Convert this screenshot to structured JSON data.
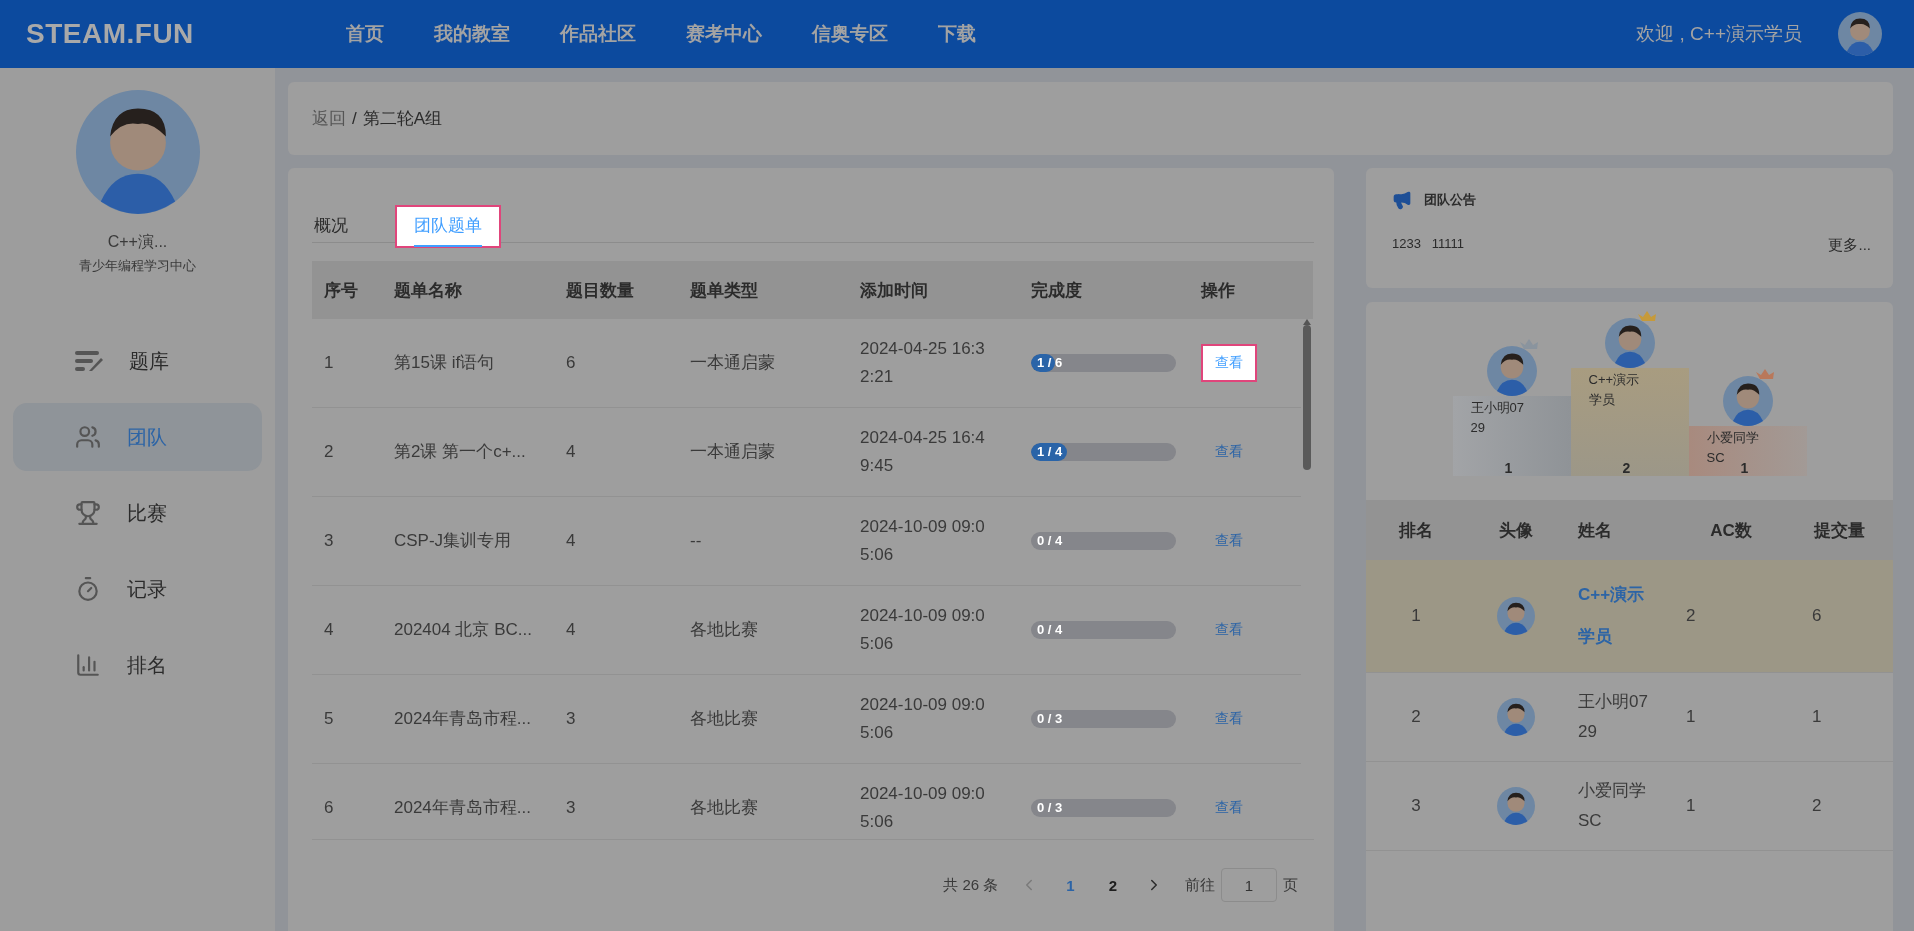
{
  "header": {
    "brand": "STEAM.FUN",
    "nav": [
      "首页",
      "我的教室",
      "作品社区",
      "赛考中心",
      "信奥专区",
      "下载"
    ],
    "welcome": "欢迎 , C++演示学员"
  },
  "sidebar": {
    "user_name": "C++演...",
    "org": "青少年编程学习中心",
    "items": [
      {
        "label": "题库",
        "selected": false
      },
      {
        "label": "团队",
        "selected": true
      },
      {
        "label": "比赛",
        "selected": false
      },
      {
        "label": "记录",
        "selected": false
      },
      {
        "label": "排名",
        "selected": false
      }
    ]
  },
  "breadcrumb": {
    "back": "返回",
    "separator": "/",
    "current": "第二轮A组"
  },
  "tabs": [
    {
      "label": "概况",
      "selected": false,
      "highlighted": false
    },
    {
      "label": "团队题单",
      "selected": true,
      "highlighted": true
    }
  ],
  "table": {
    "columns": [
      "序号",
      "题单名称",
      "题目数量",
      "题单类型",
      "添加时间",
      "完成度",
      "操作"
    ],
    "rows": [
      {
        "index": "1",
        "name": "第15课 if语句",
        "count": "6",
        "type": "一本通启蒙",
        "added": "2024-04-25 16:32:21",
        "progress": {
          "label": "1 / 6",
          "level": 0.1667
        },
        "action": {
          "label": "查看",
          "highlighted": true
        }
      },
      {
        "index": "2",
        "name": "第2课 第一个c+...",
        "count": "4",
        "type": "一本通启蒙",
        "added": "2024-04-25 16:49:45",
        "progress": {
          "label": "1 / 4",
          "level": 0.25
        },
        "action": {
          "label": "查看",
          "highlighted": false
        }
      },
      {
        "index": "3",
        "name": "CSP-J集训专用",
        "count": "4",
        "type": "--",
        "added": "2024-10-09 09:05:06",
        "progress": {
          "label": "0 / 4",
          "level": 0
        },
        "action": {
          "label": "查看",
          "highlighted": false
        }
      },
      {
        "index": "4",
        "name": "202404 北京 BC...",
        "count": "4",
        "type": "各地比赛",
        "added": "2024-10-09 09:05:06",
        "progress": {
          "label": "0 / 4",
          "level": 0
        },
        "action": {
          "label": "查看",
          "highlighted": false
        }
      },
      {
        "index": "5",
        "name": "2024年青岛市程...",
        "count": "3",
        "type": "各地比赛",
        "added": "2024-10-09 09:05:06",
        "progress": {
          "label": "0 / 3",
          "level": 0
        },
        "action": {
          "label": "查看",
          "highlighted": false
        }
      },
      {
        "index": "6",
        "name": "2024年青岛市程...",
        "count": "3",
        "type": "各地比赛",
        "added": "2024-10-09 09:05:06",
        "progress": {
          "label": "0 / 3",
          "level": 0
        },
        "action": {
          "label": "查看",
          "highlighted": false
        }
      }
    ]
  },
  "pagination": {
    "total": "共 26 条",
    "pages": [
      {
        "label": "1",
        "selected": true
      },
      {
        "label": "2",
        "selected": false
      }
    ],
    "goto_label": "前往",
    "goto_value": "1",
    "page_suffix": "页"
  },
  "announcement": {
    "title": "团队公告",
    "text": "1233   11111",
    "more": "更多..."
  },
  "podium": [
    {
      "name": "王小明0729",
      "count": "1",
      "color": "#8a949e"
    },
    {
      "name": "C++演示学员",
      "count": "2",
      "color": "#c69a3a"
    },
    {
      "name": "小爱同学SC",
      "count": "1",
      "color": "#b9785a"
    }
  ],
  "ranking": {
    "columns": [
      "排名",
      "头像",
      "姓名",
      "AC数",
      "提交量"
    ],
    "rows": [
      {
        "rank": "1",
        "name": "C++演示学员",
        "ac": "2",
        "submissions": "6",
        "current": true
      },
      {
        "rank": "2",
        "name": "王小明0729",
        "ac": "1",
        "submissions": "1",
        "current": false
      },
      {
        "rank": "3",
        "name": "小爱同学SC",
        "ac": "1",
        "submissions": "2",
        "current": false
      }
    ]
  }
}
